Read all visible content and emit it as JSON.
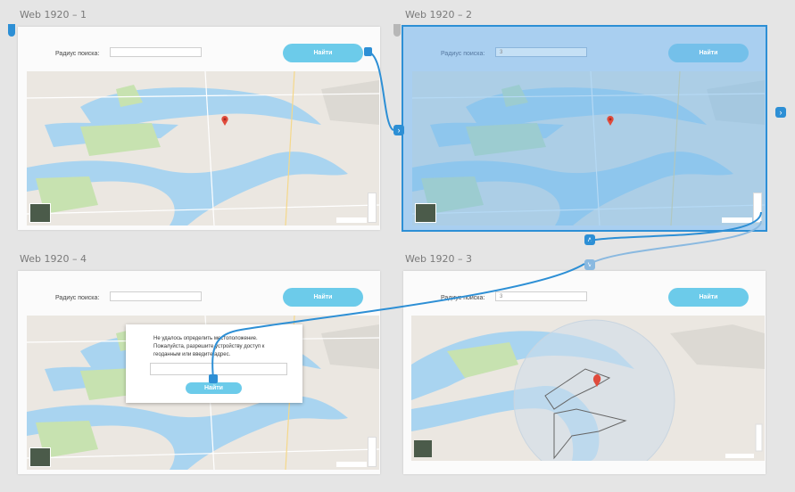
{
  "frames": [
    {
      "title": "Web 1920 – 1",
      "search_label": "Радиус поиска:",
      "search_value": "",
      "button": "Найти"
    },
    {
      "title": "Web 1920 – 2",
      "search_label": "Радиус поиска:",
      "search_value": "3",
      "button": "Найти"
    },
    {
      "title": "Web 1920 – 4",
      "search_label": "Радиус поиска:",
      "search_value": "",
      "button": "Найти"
    },
    {
      "title": "Web 1920 – 3",
      "search_label": "Радиус поиска:",
      "search_value": "3",
      "button": "Найти"
    }
  ],
  "dialog": {
    "message": "Не удалось определить местоположение. Пожалуйста, разрешите устройству доступ к геоданным или введите адрес.",
    "button": "Найти"
  },
  "colors": {
    "accent": "#2d8fd5",
    "button": "#6ccbea",
    "water": "#a9d4f0",
    "park": "#c7e2b0"
  },
  "icons": {
    "next": "chevron-right-icon",
    "up": "chevron-up-icon",
    "down": "chevron-down-icon",
    "pin": "map-pin-icon"
  }
}
